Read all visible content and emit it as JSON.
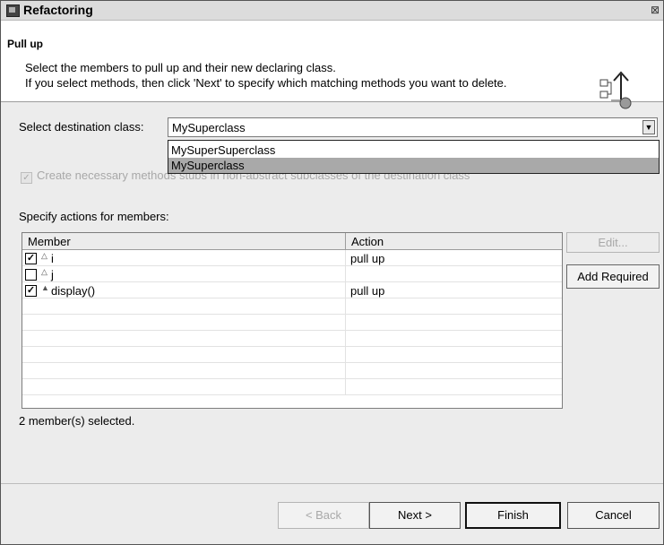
{
  "window": {
    "title": "Refactoring",
    "close_glyph": "⊠"
  },
  "header": {
    "title": "Pull up",
    "desc_line1": "Select the members to pull up and their new declaring class.",
    "desc_line2": "If you select methods, then click 'Next' to specify which matching methods you want to delete.",
    "icon": "pull-up-wizard-icon"
  },
  "destination": {
    "label": "Select destination class:",
    "selected": "MySuperclass",
    "options": [
      "MySuperSuperclass",
      "MySuperclass"
    ],
    "highlighted_index": 1
  },
  "stubs_checkbox": {
    "label": "Create necessary methods stubs in non-abstract subclasses of the destination class",
    "checked": true,
    "enabled": false
  },
  "members": {
    "label": "Specify actions for members:",
    "columns": {
      "member": "Member",
      "action": "Action"
    },
    "rows": [
      {
        "name": "i",
        "checked": true,
        "action": "pull up",
        "icon": "field-icon"
      },
      {
        "name": "j",
        "checked": false,
        "action": "",
        "icon": "field-icon"
      },
      {
        "name": "display()",
        "checked": true,
        "action": "pull up",
        "icon": "method-icon"
      }
    ],
    "empty_rows": 6
  },
  "side_buttons": {
    "edit": "Edit...",
    "add_required": "Add Required"
  },
  "status": "2 member(s) selected.",
  "buttons": {
    "back": "< Back",
    "next": "Next >",
    "finish": "Finish",
    "cancel": "Cancel"
  },
  "colors": {
    "selection": "#a9a9a9",
    "disabled_text": "#a8a8a8",
    "background": "#ececec"
  }
}
